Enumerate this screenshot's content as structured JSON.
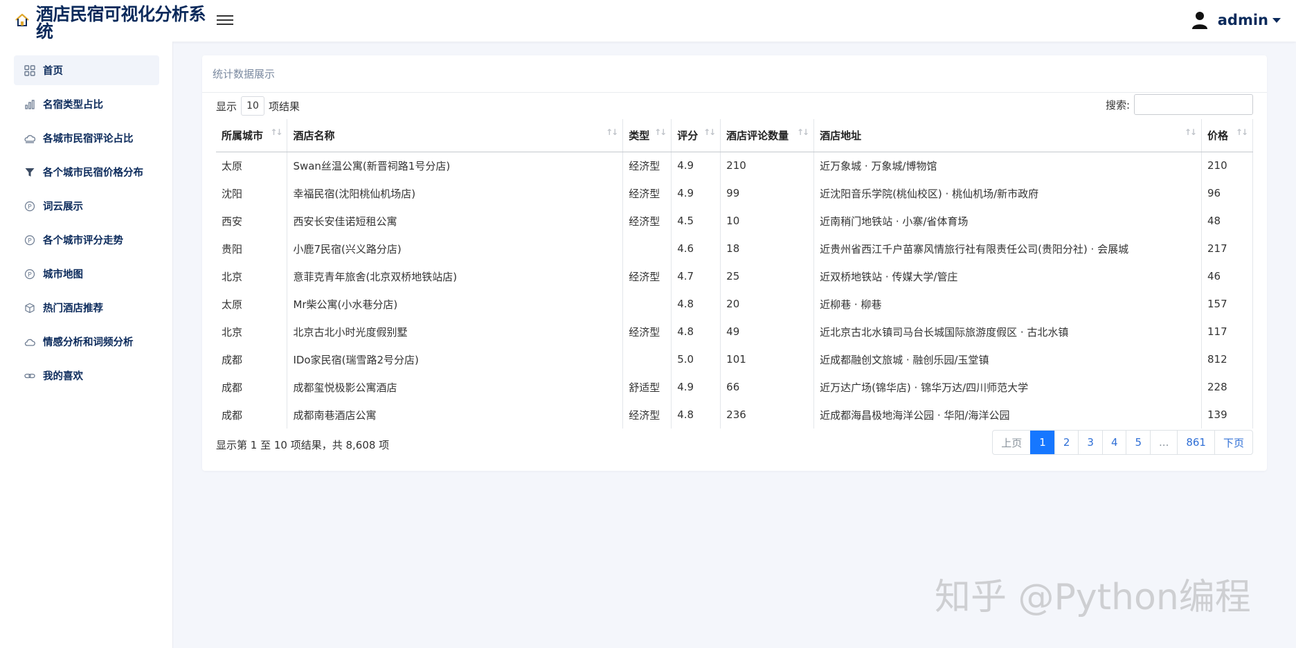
{
  "app": {
    "title": "酒店民宿可视化分析系统"
  },
  "user": {
    "name": "admin"
  },
  "sidebar": {
    "items": [
      {
        "label": "首页",
        "icon": "grid-icon",
        "active": true
      },
      {
        "label": "名宿类型占比",
        "icon": "bar-chart-icon"
      },
      {
        "label": "各城市民宿评论占比",
        "icon": "cloud-sun-icon"
      },
      {
        "label": "各个城市民宿价格分布",
        "icon": "filter-icon"
      },
      {
        "label": "词云展示",
        "icon": "p-circle-icon"
      },
      {
        "label": "各个城市评分走势",
        "icon": "p-circle-icon"
      },
      {
        "label": "城市地图",
        "icon": "p-circle-icon"
      },
      {
        "label": "热门酒店推荐",
        "icon": "box-icon"
      },
      {
        "label": "情感分析和词频分析",
        "icon": "cloud-icon"
      },
      {
        "label": "我的喜欢",
        "icon": "link-icon"
      }
    ]
  },
  "card": {
    "title": "统计数据展示"
  },
  "table": {
    "length_prefix": "显示",
    "length_value": "10",
    "length_suffix": "项结果",
    "search_label": "搜索:",
    "search_value": "",
    "columns": [
      "所属城市",
      "酒店名称",
      "类型",
      "评分",
      "酒店评论数量",
      "酒店地址",
      "价格"
    ],
    "rows": [
      [
        "太原",
        "Swan丝温公寓(新晋祠路1号分店)",
        "经济型",
        "4.9",
        "210",
        "近万象城 · 万象城/博物馆",
        "210"
      ],
      [
        "沈阳",
        "幸福民宿(沈阳桃仙机场店)",
        "经济型",
        "4.9",
        "99",
        "近沈阳音乐学院(桃仙校区) · 桃仙机场/新市政府",
        "96"
      ],
      [
        "西安",
        "西安长安佳诺短租公寓",
        "经济型",
        "4.5",
        "10",
        "近南稍门地铁站 · 小寨/省体育场",
        "48"
      ],
      [
        "贵阳",
        "小鹿7民宿(兴义路分店)",
        "",
        "4.6",
        "18",
        "近贵州省西江千户苗寨风情旅行社有限责任公司(贵阳分社) · 会展城",
        "217"
      ],
      [
        "北京",
        "意菲克青年旅舍(北京双桥地铁站店)",
        "经济型",
        "4.7",
        "25",
        "近双桥地铁站 · 传媒大学/管庄",
        "46"
      ],
      [
        "太原",
        "Mr柴公寓(小水巷分店)",
        "",
        "4.8",
        "20",
        "近柳巷 · 柳巷",
        "157"
      ],
      [
        "北京",
        "北京古北小时光度假别墅",
        "经济型",
        "4.8",
        "49",
        "近北京古北水镇司马台长城国际旅游度假区 · 古北水镇",
        "117"
      ],
      [
        "成都",
        "IDo家民宿(瑞雪路2号分店)",
        "",
        "5.0",
        "101",
        "近成都融创文旅城 · 融创乐园/玉堂镇",
        "812"
      ],
      [
        "成都",
        "成都玺悦极影公寓酒店",
        "舒适型",
        "4.9",
        "66",
        "近万达广场(锦华店) · 锦华万达/四川师范大学",
        "228"
      ],
      [
        "成都",
        "成都南巷酒店公寓",
        "经济型",
        "4.8",
        "236",
        "近成都海昌极地海洋公园 · 华阳/海洋公园",
        "139"
      ]
    ],
    "info": "显示第 1 至 10 项结果，共 8,608 项"
  },
  "pagination": {
    "prev": "上页",
    "pages": [
      "1",
      "2",
      "3",
      "4",
      "5",
      "...",
      "861"
    ],
    "next": "下页",
    "active": "1"
  },
  "watermark": {
    "text": "知乎 @Python编程"
  },
  "colors": {
    "accent": "#1677ff",
    "nav_text": "#0b2a5b",
    "background": "#f4f6fb"
  }
}
